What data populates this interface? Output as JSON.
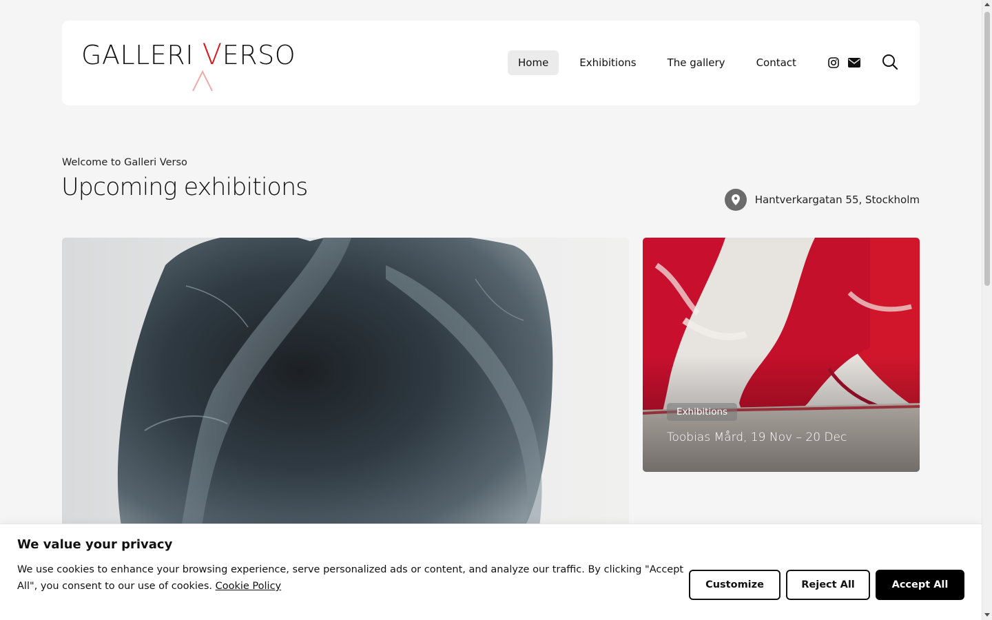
{
  "header": {
    "logo": {
      "word1": "GALLERI ",
      "accent_letter": "V",
      "word2": "ERSO",
      "accent_color": "#d4181e"
    },
    "nav": [
      {
        "label": "Home",
        "active": true
      },
      {
        "label": "Exhibitions",
        "active": false
      },
      {
        "label": "The gallery",
        "active": false
      },
      {
        "label": "Contact",
        "active": false
      }
    ],
    "icons": [
      "instagram-icon",
      "envelope-icon",
      "search-icon"
    ]
  },
  "intro": {
    "eyebrow": "Welcome to Galleri Verso",
    "title": "Upcoming exhibitions",
    "location": "Hantverkargatan 55, Stockholm"
  },
  "cards": {
    "featured": {
      "image": "dark-stone-sculpture"
    },
    "secondary": {
      "image": "red-white-abstract-painting",
      "badge": "Exhibitions",
      "title": "Toobias Mård, 19 Nov – 20 Dec"
    }
  },
  "cookie_banner": {
    "title": "We value your privacy",
    "text": "We use cookies to enhance your browsing experience, serve personalized ads or content, and analyze our traffic. By clicking \"Accept All\", you consent to our use of cookies.",
    "link": "Cookie Policy",
    "buttons": {
      "customize": "Customize",
      "reject": "Reject All",
      "accept": "Accept All"
    }
  }
}
